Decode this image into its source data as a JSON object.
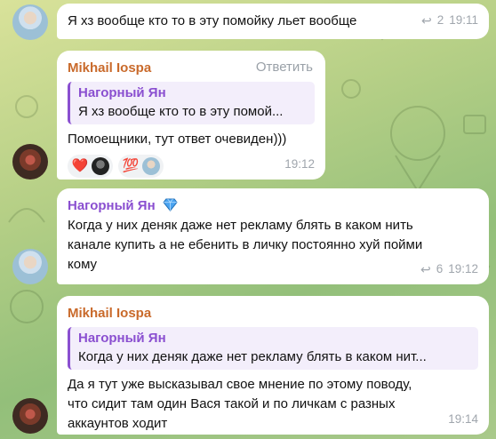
{
  "messages": [
    {
      "text": "Я хз вообще кто то в эту помойку льет вообще",
      "forwards": "2",
      "time": "19:11"
    },
    {
      "sender": "Mikhail Iospa",
      "reply_action": "Ответить",
      "quote_name": "Нагорный Ян",
      "quote_text": "Я хз вообще кто то в эту помой...",
      "text": "Помоещники, тут ответ очевиден)))",
      "reactions": [
        {
          "icon": "heart-icon",
          "emoji": "❤️"
        },
        {
          "icon": "hundred-icon",
          "emoji": "💯"
        }
      ],
      "time": "19:12"
    },
    {
      "sender": "Нагорный Ян",
      "badge_icon": "diamond-icon",
      "text_lines": [
        "Когда у них деняк даже нет рекламу блять в каком нить",
        "канале купить а не ебенить в личку постоянно хуй пойми",
        "кому"
      ],
      "forwards": "6",
      "time": "19:12"
    },
    {
      "sender": "Mikhail Iospa",
      "quote_name": "Нагорный Ян",
      "quote_text": "Когда у них деняк даже нет рекламу блять в каком нит...",
      "text_lines": [
        "Да я тут уже высказывал свое мнение по этому поводу,",
        "что сидит там один Вася такой и по личкам с разных",
        "аккаунтов ходит"
      ],
      "time": "19:14"
    }
  ]
}
